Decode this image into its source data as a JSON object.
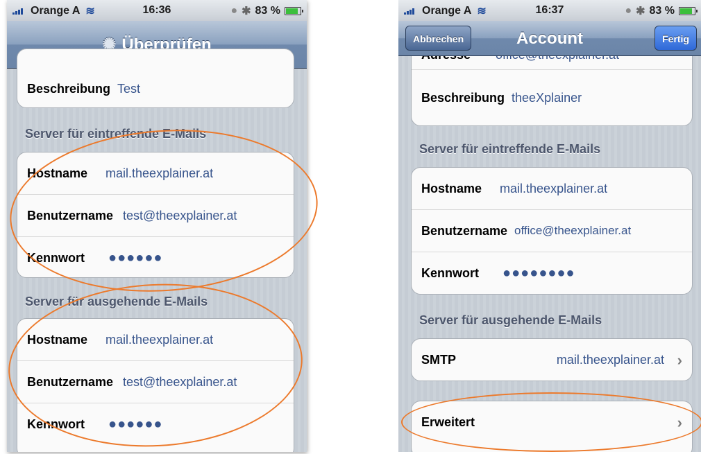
{
  "left": {
    "status": {
      "carrier": "Orange A",
      "time": "16:36",
      "battery": "83 %",
      "battery_level": 0.83
    },
    "title": "Überprüfen",
    "description": {
      "label": "Beschreibung",
      "value": "Test"
    },
    "incoming": {
      "header": "Server für eintreffende E-Mails",
      "rows": [
        {
          "label": "Hostname",
          "value": "mail.theexplainer.at"
        },
        {
          "label": "Benutzername",
          "value": "test@theexplainer.at"
        },
        {
          "label": "Kennwort",
          "value": "●●●●●●"
        }
      ]
    },
    "outgoing": {
      "header": "Server für ausgehende E-Mails",
      "rows": [
        {
          "label": "Hostname",
          "value": "mail.theexplainer.at"
        },
        {
          "label": "Benutzername",
          "value": "test@theexplainer.at"
        },
        {
          "label": "Kennwort",
          "value": "●●●●●●"
        }
      ]
    }
  },
  "right": {
    "status": {
      "carrier": "Orange A",
      "time": "16:37",
      "battery": "83 %",
      "battery_level": 0.83
    },
    "title": "Account",
    "cancel_label": "Abbrechen",
    "done_label": "Fertig",
    "address": {
      "label": "Adresse",
      "value": "office@theexplainer.at"
    },
    "description": {
      "label": "Beschreibung",
      "value": "theeXplainer"
    },
    "incoming": {
      "header": "Server für eintreffende E-Mails",
      "rows": [
        {
          "label": "Hostname",
          "value": "mail.theexplainer.at"
        },
        {
          "label": "Benutzername",
          "value": "office@theexplainer.at"
        },
        {
          "label": "Kennwort",
          "value": "●●●●●●●●"
        }
      ]
    },
    "outgoing": {
      "header": "Server für ausgehende E-Mails",
      "smtp": {
        "label": "SMTP",
        "value": "mail.theexplainer.at"
      }
    },
    "advanced": {
      "label": "Erweitert"
    }
  },
  "colors": {
    "annotation": "#ec7a2c",
    "value_text": "#37548c",
    "nav_bar": "#6f89ac"
  }
}
